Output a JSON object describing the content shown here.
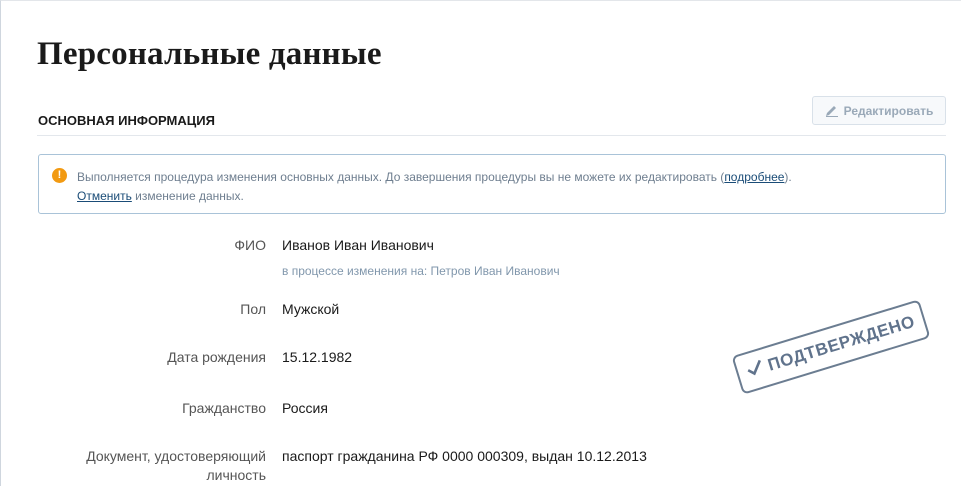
{
  "page": {
    "title": "Персональные данные"
  },
  "section": {
    "title": "ОСНОВНАЯ ИНФОРМАЦИЯ",
    "edit_label": "Редактировать"
  },
  "notice": {
    "icon": "!",
    "text_main": "Выполняется процедура изменения основных данных. До завершения процедуры вы не можете их редактировать (",
    "more_link": "подробнее",
    "text_main_end": ").",
    "cancel_link": "Отменить",
    "text_tail": " изменение данных."
  },
  "fields": {
    "fio": {
      "label": "ФИО",
      "value": "Иванов Иван Иванович",
      "pending": "в процессе изменения на: Петров Иван Иванович"
    },
    "gender": {
      "label": "Пол",
      "value": "Мужской"
    },
    "birth": {
      "label": "Дата рождения",
      "value": "15.12.1982"
    },
    "citizenship": {
      "label": "Гражданство",
      "value": "Россия"
    },
    "document": {
      "label_line1": "Документ, удостоверяющий",
      "label_line2": "личность",
      "value": "паспорт гражданина РФ 0000 000309, выдан 10.12.2013"
    }
  },
  "stamp": {
    "text": "ПОДТВЕРЖДЕНО"
  },
  "colors": {
    "accent": "#1a4c77",
    "warning": "#f29a12",
    "notice_border": "#a9c3d8"
  }
}
